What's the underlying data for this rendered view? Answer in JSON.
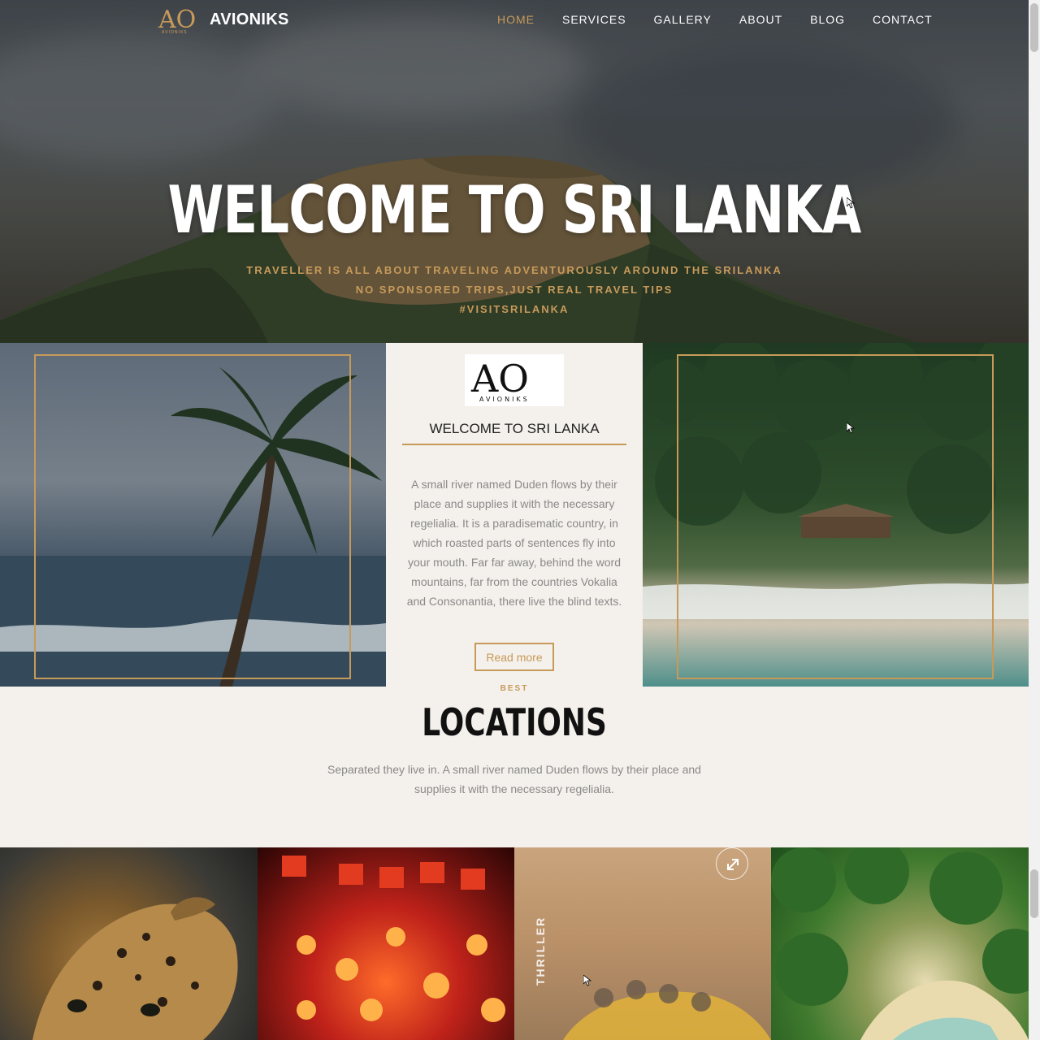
{
  "brand": {
    "name": "AVIONIKS",
    "logo_monogram": "AO",
    "logo_subtext": "AVIONIKS"
  },
  "nav": {
    "items": [
      {
        "label": "HOME",
        "active": true
      },
      {
        "label": "SERVICES"
      },
      {
        "label": "GALLERY"
      },
      {
        "label": "ABOUT"
      },
      {
        "label": "BLOG"
      },
      {
        "label": "CONTACT"
      }
    ]
  },
  "hero": {
    "title": "WELCOME TO SRI LANKA",
    "subtitle_lines": [
      "TRAVELLER IS ALL ABOUT TRAVELING ADVENTUROUSLY AROUND THE SRILANKA",
      "NO SPONSORED TRIPS,JUST REAL TRAVEL TIPS",
      "#VISITSRILANKA"
    ]
  },
  "intro": {
    "title": "WELCOME TO SRI LANKA",
    "text": "A small river named Duden flows by their place and supplies it with the necessary regelialia. It is a paradisematic country, in which roasted parts of sentences fly into your mouth. Far far away, behind the word mountains, far from the countries Vokalia and Consonantia, there live the blind texts.",
    "button": "Read more"
  },
  "locations": {
    "eyebrow": "BEST",
    "title": "LOCATIONS",
    "text": "Separated they live in. A small river named Duden flows by their place and supplies it with the necessary regelialia.",
    "tiles": [
      {
        "name": "leopard"
      },
      {
        "name": "lanterns"
      },
      {
        "name": "rafting",
        "label": "THRILLER"
      },
      {
        "name": "beach-aerial"
      }
    ]
  },
  "colors": {
    "accent": "#c79a5a",
    "background": "#f4f0eb",
    "heading": "#111111",
    "body_text": "#8a8a8a"
  }
}
